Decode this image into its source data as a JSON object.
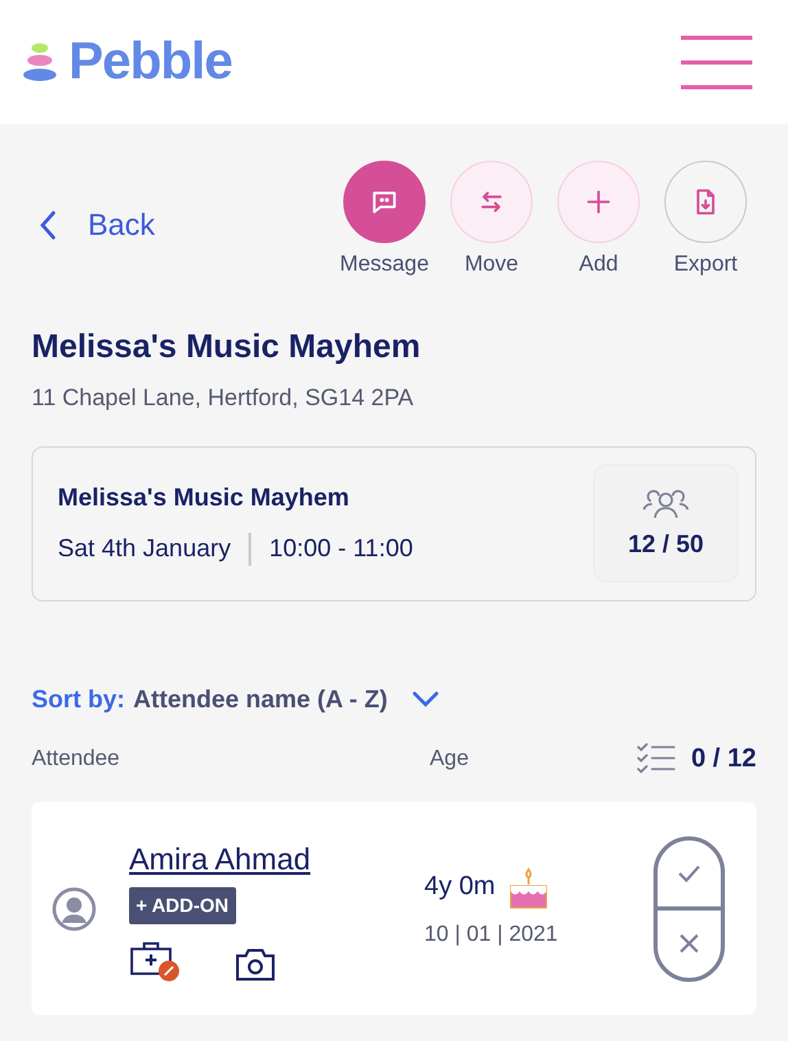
{
  "header": {
    "logo": "Pebble"
  },
  "back": {
    "label": "Back"
  },
  "actions": [
    {
      "label": "Message",
      "kind": "primary"
    },
    {
      "label": "Move",
      "kind": "tint"
    },
    {
      "label": "Add",
      "kind": "tint"
    },
    {
      "label": "Export",
      "kind": "outline"
    }
  ],
  "venue": {
    "title": "Melissa's Music Mayhem",
    "address": "11 Chapel Lane, Hertford, SG14 2PA"
  },
  "session": {
    "title": "Melissa's Music Mayhem",
    "date": "Sat 4th January",
    "time": "10:00 - 11:00",
    "capacity": "12 / 50"
  },
  "sort": {
    "label": "Sort by:",
    "value": "Attendee name (A - Z)"
  },
  "columns": {
    "attendee": "Attendee",
    "age": "Age",
    "checked_in": "0 / 12"
  },
  "attendees": [
    {
      "name": "Amira Ahmad",
      "badge": "+ ADD-ON",
      "age": "4y 0m",
      "birthday": true,
      "dob": "10 | 01 | 2021"
    }
  ]
}
